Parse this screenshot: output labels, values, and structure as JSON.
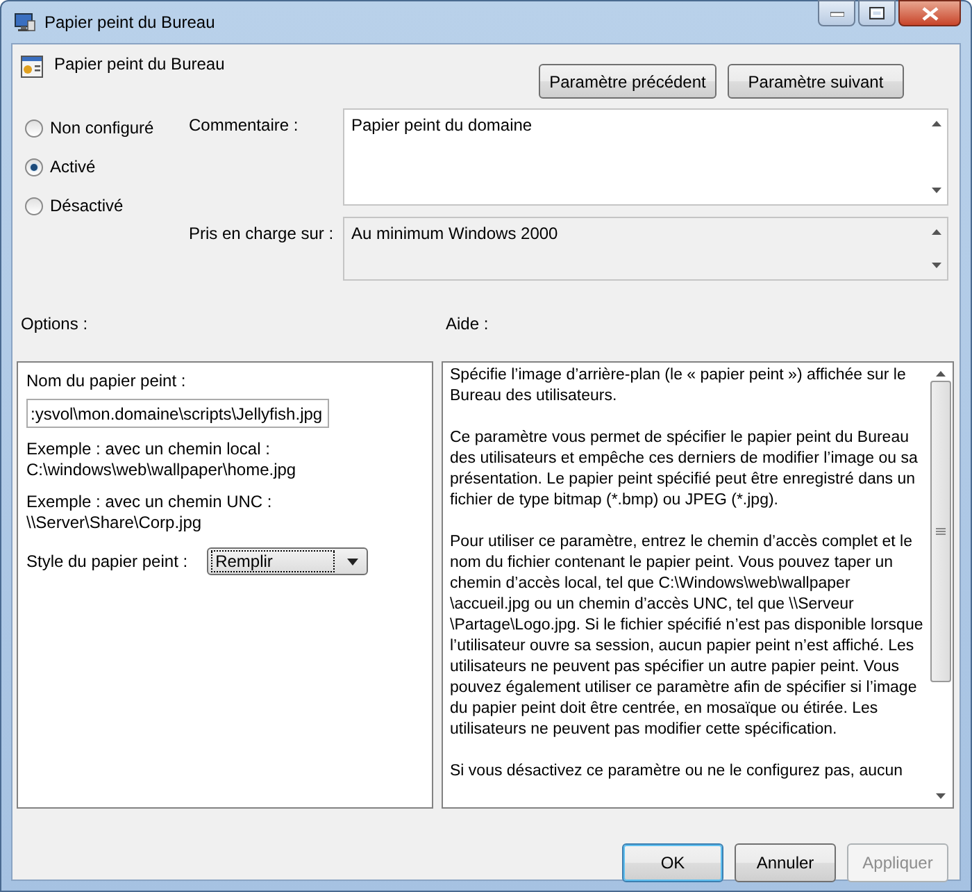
{
  "window": {
    "title": "Papier peint du Bureau"
  },
  "setting": {
    "title": "Papier peint du Bureau"
  },
  "nav_buttons": [
    {
      "label": "Paramètre précédent"
    },
    {
      "label": "Paramètre suivant"
    }
  ],
  "state_options": [
    {
      "label": "Non configuré",
      "selected": false
    },
    {
      "label": "Activé",
      "selected": true
    },
    {
      "label": "Désactivé",
      "selected": false
    }
  ],
  "comment": {
    "label": "Commentaire :",
    "value": "Papier peint du domaine"
  },
  "supported_on": {
    "label": "Pris en charge sur :",
    "value": "Au minimum Windows 2000"
  },
  "options": {
    "label": "Options :",
    "name_label": "Nom du papier peint :",
    "name_value": ":ysvol\\mon.domaine\\scripts\\Jellyfish.jpg",
    "examples": [
      "Exemple : avec un chemin local :\nC:\\windows\\web\\wallpaper\\home.jpg",
      "Exemple : avec un chemin UNC :\n\\\\Server\\Share\\Corp.jpg"
    ],
    "style_label": "Style du papier peint :",
    "style_value": "Remplir"
  },
  "help": {
    "label": "Aide :",
    "paragraphs": [
      "Spécifie l’image d’arrière-plan (le « papier peint ») affichée sur le Bureau des utilisateurs.",
      "Ce paramètre vous permet de spécifier le papier peint du Bureau des utilisateurs et empêche ces derniers de modifier l’image ou sa présentation. Le papier peint spécifié peut être enregistré dans un fichier de type bitmap (*.bmp) ou JPEG (*.jpg).",
      "Pour utiliser ce paramètre, entrez le chemin d’accès complet et le nom du fichier contenant le papier peint. Vous pouvez taper un chemin d’accès local, tel que C:\\Windows\\web\\wallpaper \\accueil.jpg ou un chemin d’accès UNC, tel que \\\\Serveur \\Partage\\Logo.jpg. Si le fichier spécifié n’est pas disponible lorsque l’utilisateur ouvre sa session, aucun papier peint n’est affiché. Les utilisateurs ne peuvent pas spécifier un autre papier peint. Vous pouvez également utiliser ce paramètre afin de spécifier si l’image du papier peint doit être centrée, en mosaïque ou étirée. Les utilisateurs ne peuvent pas modifier cette spécification.",
      "Si vous désactivez ce paramètre ou ne le configurez pas, aucun"
    ]
  },
  "buttons": [
    {
      "label": "OK",
      "default": true,
      "disabled": false
    },
    {
      "label": "Annuler",
      "default": false,
      "disabled": false
    },
    {
      "label": "Appliquer",
      "default": false,
      "disabled": true
    }
  ]
}
